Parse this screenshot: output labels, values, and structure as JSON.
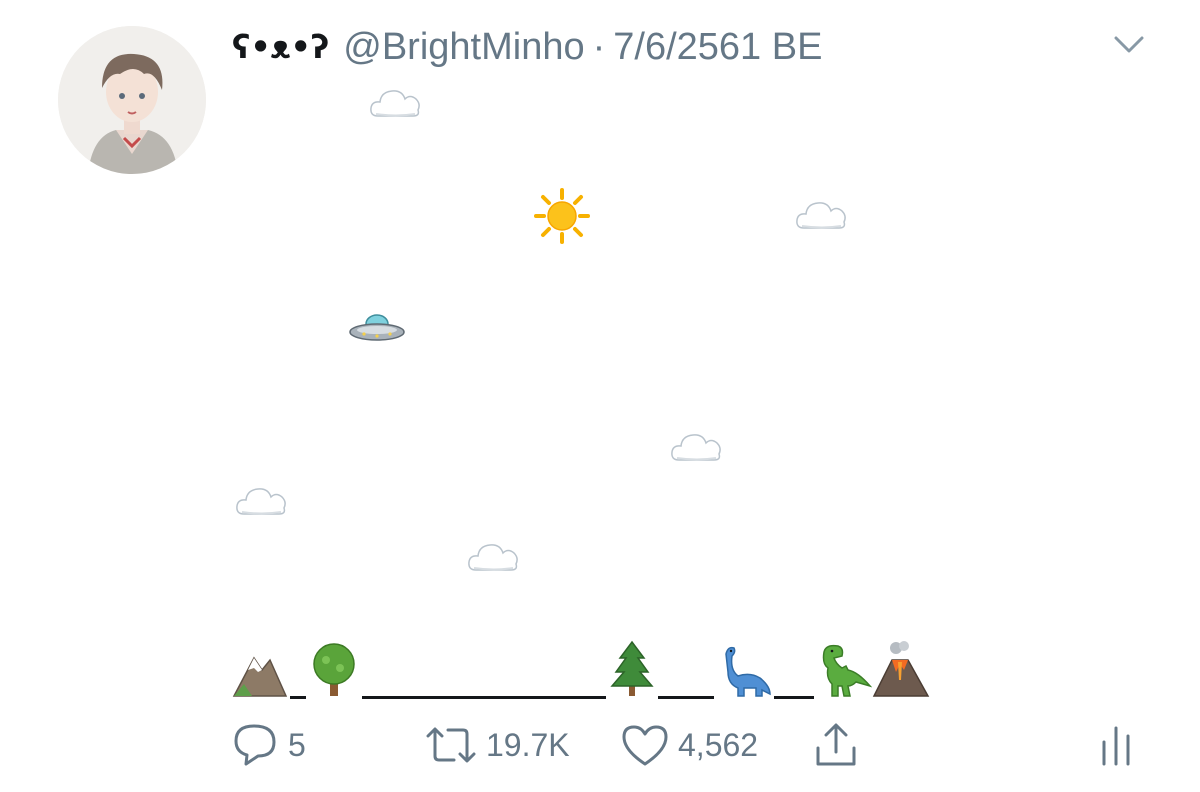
{
  "tweet": {
    "display_name": "ʕ•ᴥ•ʔ",
    "handle": "@BrightMinho",
    "separator": "·",
    "date": "7/6/2561 BE",
    "scene": {
      "sky": [
        {
          "name": "cloud-icon",
          "glyph": "☁"
        },
        {
          "name": "sun-icon",
          "glyph": "☀"
        },
        {
          "name": "cloud-icon",
          "glyph": "☁"
        },
        {
          "name": "ufo-icon",
          "glyph": "🛸"
        },
        {
          "name": "cloud-icon",
          "glyph": "☁"
        },
        {
          "name": "cloud-icon",
          "glyph": "☁"
        },
        {
          "name": "cloud-icon",
          "glyph": "☁"
        }
      ],
      "ground": [
        "⛰",
        "🌳",
        "🌲",
        "🦕",
        "🦖",
        "🌋"
      ]
    }
  },
  "actions": {
    "reply_count": "5",
    "retweet_count": "19.7K",
    "like_count": "4,562"
  },
  "colors": {
    "text_primary": "#14171a",
    "text_secondary": "#657786",
    "background": "#ffffff"
  }
}
